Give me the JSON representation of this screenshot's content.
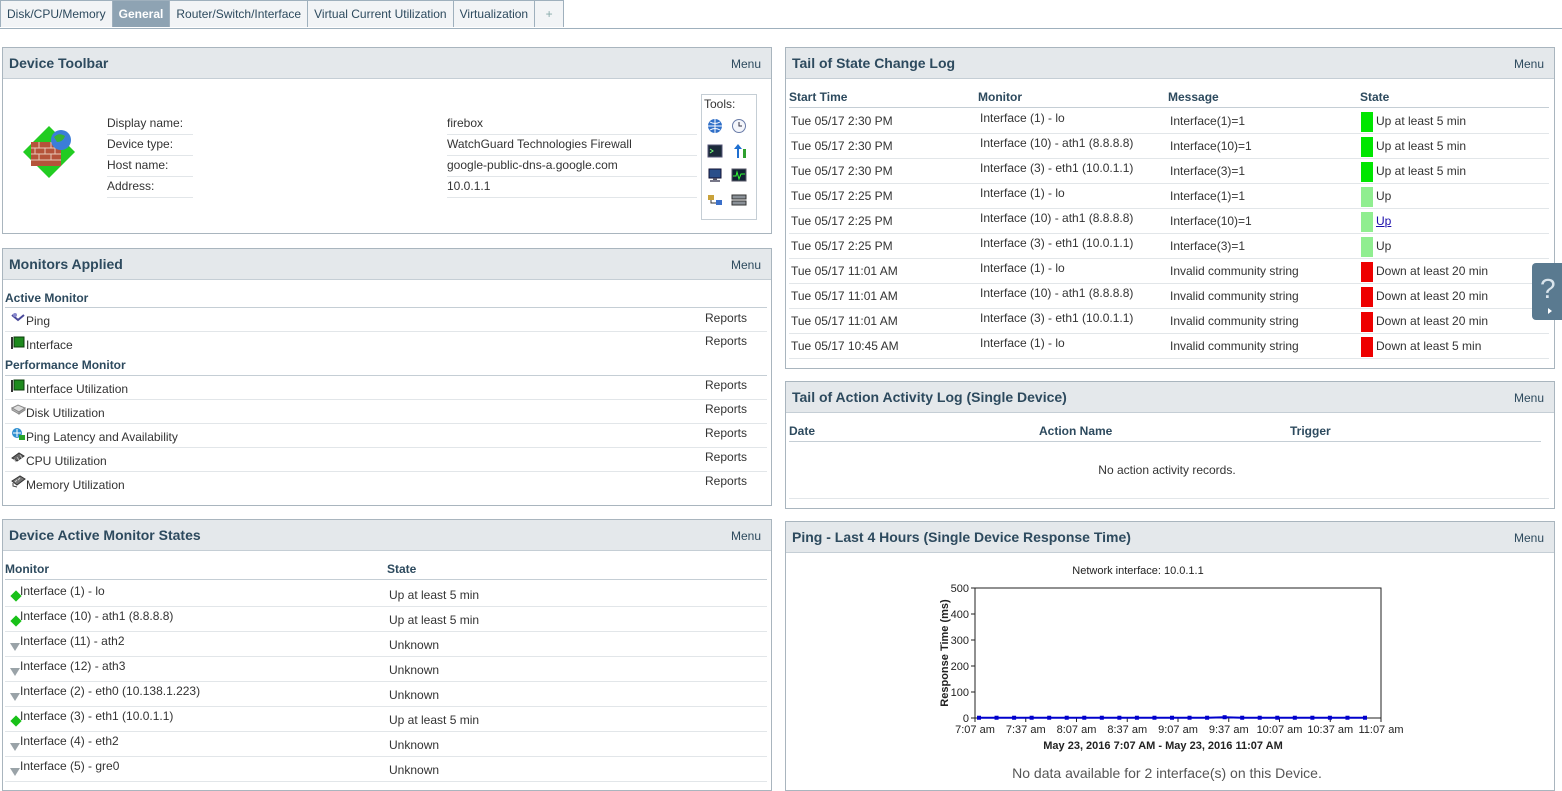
{
  "tabs": [
    {
      "label": "Disk/CPU/Memory"
    },
    {
      "label": "General"
    },
    {
      "label": "Router/Switch/Interface"
    },
    {
      "label": "Virtual Current Utilization"
    },
    {
      "label": "Virtualization"
    },
    {
      "label": "+"
    }
  ],
  "menu_label": "Menu",
  "reports_label": "Reports",
  "toolbar": {
    "title": "Device Toolbar",
    "fields": [
      {
        "label": "Display name:",
        "value": "firebox"
      },
      {
        "label": "Device type:",
        "value": "WatchGuard Technologies Firewall"
      },
      {
        "label": "Host name:",
        "value": "google-public-dns-a.google.com"
      },
      {
        "label": "Address:",
        "value": "10.0.1.1"
      }
    ],
    "tools_label": "Tools:"
  },
  "monitors": {
    "title": "Monitors Applied",
    "active_heading": "Active Monitor",
    "active": [
      {
        "name": "Ping",
        "icon": "ping-icon"
      },
      {
        "name": "Interface",
        "icon": "interface-icon"
      }
    ],
    "performance_heading": "Performance Monitor",
    "performance": [
      {
        "name": "Interface Utilization",
        "icon": "interface-icon"
      },
      {
        "name": "Disk Utilization",
        "icon": "disk-icon"
      },
      {
        "name": "Ping Latency and Availability",
        "icon": "ping-latency-icon"
      },
      {
        "name": "CPU Utilization",
        "icon": "cpu-icon"
      },
      {
        "name": "Memory Utilization",
        "icon": "memory-icon"
      }
    ]
  },
  "states": {
    "title": "Device Active Monitor States",
    "col_monitor": "Monitor",
    "col_state": "State",
    "rows": [
      {
        "monitor": "Interface (1) - lo",
        "state": "Up at least 5 min",
        "status": "up"
      },
      {
        "monitor": "Interface (10) - ath1 (8.8.8.8)",
        "state": "Up at least 5 min",
        "status": "up"
      },
      {
        "monitor": "Interface (11) - ath2",
        "state": "Unknown",
        "status": "unknown"
      },
      {
        "monitor": "Interface (12) - ath3",
        "state": "Unknown",
        "status": "unknown"
      },
      {
        "monitor": "Interface (2) - eth0 (10.138.1.223)",
        "state": "Unknown",
        "status": "unknown"
      },
      {
        "monitor": "Interface (3) - eth1 (10.0.1.1)",
        "state": "Up at least 5 min",
        "status": "up"
      },
      {
        "monitor": "Interface (4) - eth2",
        "state": "Unknown",
        "status": "unknown"
      },
      {
        "monitor": "Interface (5) - gre0",
        "state": "Unknown",
        "status": "unknown"
      }
    ]
  },
  "statelog": {
    "title": "Tail of State Change Log",
    "columns": [
      "Start Time",
      "Monitor",
      "Message",
      "State"
    ],
    "rows": [
      {
        "time": "Tue 05/17 2:30 PM",
        "monitor": "Interface (1) - lo",
        "message": "Interface(1)=1",
        "state": "Up at least 5 min",
        "color": "#00e600",
        "link": false
      },
      {
        "time": "Tue 05/17 2:30 PM",
        "monitor": "Interface (10) - ath1 (8.8.8.8)",
        "message": "Interface(10)=1",
        "state": "Up at least 5 min",
        "color": "#00e600",
        "link": false
      },
      {
        "time": "Tue 05/17 2:30 PM",
        "monitor": "Interface (3) - eth1 (10.0.1.1)",
        "message": "Interface(3)=1",
        "state": "Up at least 5 min",
        "color": "#00e600",
        "link": false
      },
      {
        "time": "Tue 05/17 2:25 PM",
        "monitor": "Interface (1) - lo",
        "message": "Interface(1)=1",
        "state": "Up",
        "color": "#90ee90",
        "link": false
      },
      {
        "time": "Tue 05/17 2:25 PM",
        "monitor": "Interface (10) - ath1 (8.8.8.8)",
        "message": "Interface(10)=1",
        "state": "Up",
        "color": "#90ee90",
        "link": true
      },
      {
        "time": "Tue 05/17 2:25 PM",
        "monitor": "Interface (3) - eth1 (10.0.1.1)",
        "message": "Interface(3)=1",
        "state": "Up",
        "color": "#90ee90",
        "link": false
      },
      {
        "time": "Tue 05/17 11:01 AM",
        "monitor": "Interface (1) - lo",
        "message": "Invalid community string",
        "state": "Down at least 20 min",
        "color": "#ee0000",
        "link": false
      },
      {
        "time": "Tue 05/17 11:01 AM",
        "monitor": "Interface (10) - ath1 (8.8.8.8)",
        "message": "Invalid community string",
        "state": "Down at least 20 min",
        "color": "#ee0000",
        "link": false
      },
      {
        "time": "Tue 05/17 11:01 AM",
        "monitor": "Interface (3) - eth1 (10.0.1.1)",
        "message": "Invalid community string",
        "state": "Down at least 20 min",
        "color": "#ee0000",
        "link": false
      },
      {
        "time": "Tue 05/17 10:45 AM",
        "monitor": "Interface (1) - lo",
        "message": "Invalid community string",
        "state": "Down at least 5 min",
        "color": "#ee0000",
        "link": false
      }
    ]
  },
  "actionlog": {
    "title": "Tail of Action Activity Log (Single Device)",
    "columns": [
      "Date",
      "Action Name",
      "Trigger"
    ],
    "empty": "No action activity records."
  },
  "ping": {
    "title": "Ping - Last 4 Hours (Single Device Response Time)",
    "footer": "No data available for 2 interface(s) on this Device."
  },
  "chart_data": {
    "type": "line",
    "title": "Network interface: 10.0.1.1",
    "ylabel": "Response Time (ms)",
    "xlabel": "May 23, 2016 7:07 AM - May 23, 2016 11:07 AM",
    "ylim": [
      0,
      500
    ],
    "yticks": [
      0,
      100,
      200,
      300,
      400,
      500
    ],
    "xticks": [
      "7:07 am",
      "7:37 am",
      "8:07 am",
      "8:37 am",
      "9:07 am",
      "9:37 am",
      "10:07 am",
      "10:37 am",
      "11:07 am"
    ],
    "series": [
      {
        "values": [
          1,
          1,
          1,
          1,
          1,
          1,
          1,
          1,
          1,
          1,
          1,
          1,
          1,
          1,
          3,
          1,
          1,
          1,
          1,
          1,
          1,
          1,
          1
        ],
        "color": "#0000cc"
      }
    ],
    "grid": false,
    "legend": "none"
  }
}
